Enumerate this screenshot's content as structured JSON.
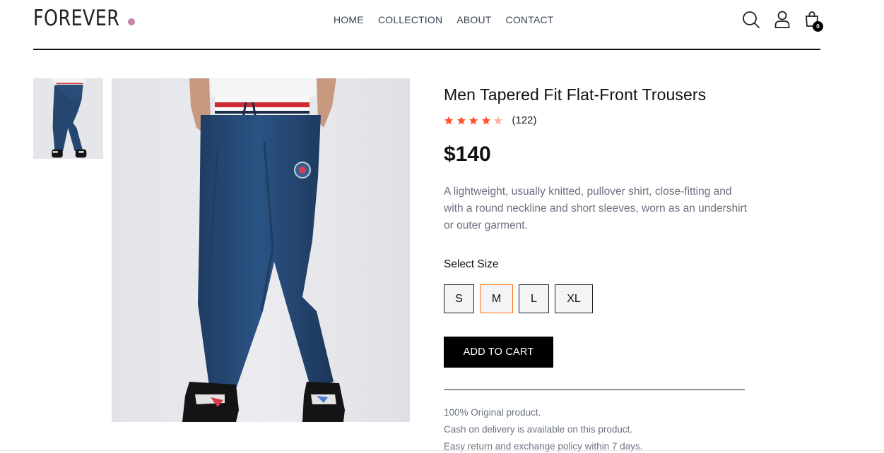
{
  "brand": {
    "name": "FOREVER",
    "dot_color": "#c586a5"
  },
  "nav": {
    "items": [
      "HOME",
      "COLLECTION",
      "ABOUT",
      "CONTACT"
    ]
  },
  "header_icons": {
    "search": "search-icon",
    "profile": "user-icon",
    "cart": "shopping-bag-icon",
    "cart_count": "0"
  },
  "gallery": {
    "thumbnails": [
      "navy-trousers-thumbnail"
    ],
    "main_image": "navy-trousers-photo"
  },
  "product": {
    "title": "Men Tapered Fit Flat-Front Trousers",
    "rating_value": 4,
    "rating_max": 5,
    "rating_count": "(122)",
    "price": "$140",
    "description": "A lightweight, usually knitted, pullover shirt, close-fitting and with a round neckline and short sleeves, worn as an undershirt or outer garment.",
    "star_color": "#ff532e",
    "star_empty_color": "#ffb3a5"
  },
  "size_selector": {
    "label": "Select Size",
    "sizes": [
      "S",
      "M",
      "L",
      "XL"
    ],
    "selected": "M"
  },
  "cart_button": {
    "label": "ADD TO CART"
  },
  "policies": [
    "100% Original product.",
    "Cash on delivery is available on this product.",
    "Easy return and exchange policy within 7 days."
  ],
  "colors": {
    "selected_border": "#f97316",
    "text_muted": "#6b7280",
    "button_bg": "#000000"
  }
}
